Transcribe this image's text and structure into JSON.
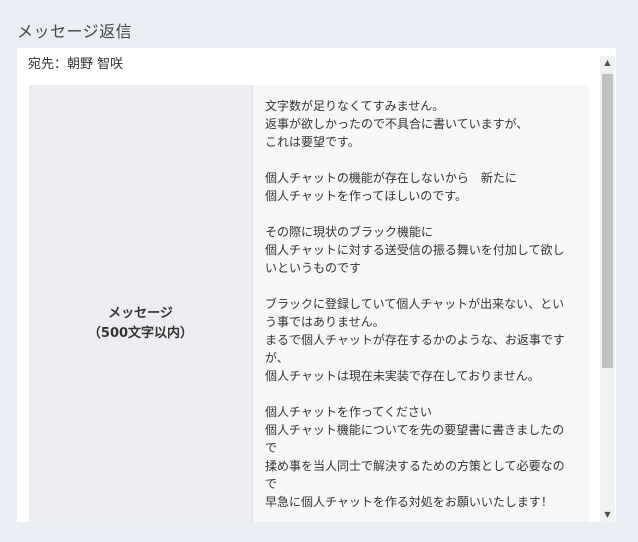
{
  "page": {
    "title": "メッセージ返信"
  },
  "recipient": {
    "text": "宛先：朝野 智咲"
  },
  "message": {
    "label_line1": "メッセージ",
    "label_line2": "（500文字以内）",
    "body": "文字数が足りなくてすみません。\n返事が欲しかったので不具合に書いていますが、\nこれは要望です。\n\n個人チャットの機能が存在しないから　新たに\n個人チャットを作ってほしいのです。\n\nその際に現状のブラック機能に\n個人チャットに対する送受信の振る舞いを付加して欲しいというものです\n\nブラックに登録していて個人チャットが出来ない、という事ではありません。\nまるで個人チャットが存在するかのような、お返事ですが、\n個人チャットは現在未実装で存在しておりません。\n\n個人チャットを作ってください\n個人チャット機能についてを先の要望書に書きましたので\n揉め事を当人同士で解決するための方策として必要なので\n早急に個人チャットを作る対処をお願いいたします！"
  },
  "scrollbar": {
    "up": "▲",
    "down": "▼",
    "position": 0
  }
}
